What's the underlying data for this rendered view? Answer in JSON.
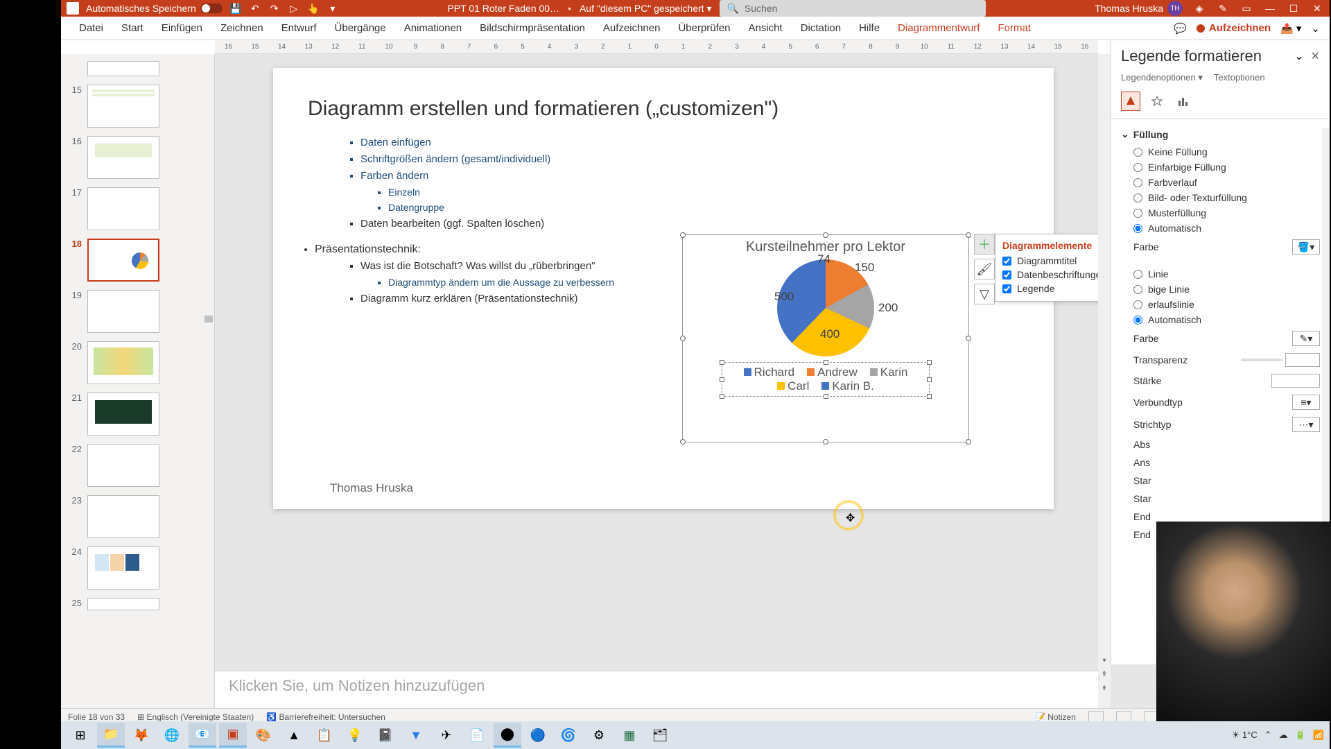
{
  "titlebar": {
    "autosave_label": "Automatisches Speichern",
    "filename": "PPT 01 Roter Faden 00…",
    "saved_status": "Auf \"diesem PC\" gespeichert",
    "search_placeholder": "Suchen",
    "user_name": "Thomas Hruska",
    "user_initials": "TH"
  },
  "ribbon": {
    "tabs": [
      "Datei",
      "Start",
      "Einfügen",
      "Zeichnen",
      "Entwurf",
      "Übergänge",
      "Animationen",
      "Bildschirmpräsentation",
      "Aufzeichnen",
      "Überprüfen",
      "Ansicht",
      "Dictation",
      "Hilfe",
      "Diagrammentwurf",
      "Format"
    ],
    "record_btn": "Aufzeichnen"
  },
  "ruler_h": [
    "16",
    "15",
    "14",
    "13",
    "12",
    "11",
    "10",
    "9",
    "8",
    "7",
    "6",
    "5",
    "4",
    "3",
    "2",
    "1",
    "0",
    "1",
    "2",
    "3",
    "4",
    "5",
    "6",
    "7",
    "8",
    "9",
    "10",
    "11",
    "12",
    "13",
    "14",
    "15",
    "16"
  ],
  "thumbs": [
    {
      "num": ""
    },
    {
      "num": "15"
    },
    {
      "num": "16"
    },
    {
      "num": "17"
    },
    {
      "num": "18",
      "selected": true
    },
    {
      "num": "19"
    },
    {
      "num": "20"
    },
    {
      "num": "21"
    },
    {
      "num": "22"
    },
    {
      "num": "23"
    },
    {
      "num": "24"
    },
    {
      "num": "25"
    }
  ],
  "slide": {
    "title": "Diagramm erstellen und formatieren („customizen\")",
    "bullets": {
      "b1": "Daten einfügen",
      "b2": "Schriftgrößen ändern (gesamt/individuell)",
      "b3": "Farben ändern",
      "b3a": "Einzeln",
      "b3b": "Datengruppe",
      "b4": "Daten bearbeiten (ggf. Spalten löschen)",
      "s2": "Präsentationstechnik:",
      "s2a": "Was ist die Botschaft? Was willst du „rüberbringen\"",
      "s2b": "Diagrammtyp ändern um die Aussage zu verbessern",
      "s2c": "Diagramm kurz erklären (Präsentationstechnik)"
    },
    "footer": "Thomas Hruska"
  },
  "chart_data": {
    "type": "pie",
    "title": "Kursteilnehmer pro Lektor",
    "series": [
      {
        "name": "Richard",
        "value": 500,
        "color": "#4472c4"
      },
      {
        "name": "Andrew",
        "value": 150,
        "color": "#ed7d31"
      },
      {
        "name": "Karin",
        "value": 200,
        "color": "#a5a5a5"
      },
      {
        "name": "Carl",
        "value": 400,
        "color": "#ffc000"
      },
      {
        "name": "Karin B.",
        "value": 74,
        "color": "#70ad47"
      }
    ],
    "labels": {
      "l74": "74",
      "l150": "150",
      "l200": "200",
      "l400": "400",
      "l500": "500"
    }
  },
  "chart_popup": {
    "title": "Diagrammelemente",
    "items": {
      "i1": "Diagrammtitel",
      "i2": "Datenbeschriftungen",
      "i3": "Legende"
    }
  },
  "format_pane": {
    "title": "Legende formatieren",
    "tab1": "Legendenoptionen",
    "tab2": "Textoptionen",
    "section_fill": "Füllung",
    "fill_opts": {
      "none": "Keine Füllung",
      "solid": "Einfarbige Füllung",
      "gradient": "Farbverlauf",
      "picture": "Bild- oder Texturfüllung",
      "pattern": "Musterfüllung",
      "auto": "Automatisch"
    },
    "color_label": "Farbe",
    "line_opts": {
      "noline": "Linie",
      "solidline": "bige Linie",
      "gradientline": "erlaufslinie",
      "autoline": "Automatisch"
    },
    "line_color": "Farbe",
    "transparency": "Transparenz",
    "width": "Stärke",
    "compound": "Verbundtyp",
    "dash": "Strichtyp",
    "cap": "Abs",
    "join": "Ans",
    "begin_arrow": "Star",
    "begin_size": "Star",
    "end_arrow": "End",
    "end_size": "End"
  },
  "notes": {
    "placeholder": "Klicken Sie, um Notizen hinzuzufügen"
  },
  "statusbar": {
    "slide_count": "Folie 18 von 33",
    "language": "Englisch (Vereinigte Staaten)",
    "accessibility": "Barrierefreiheit: Untersuchen",
    "notes_btn": "Notizen"
  },
  "taskbar": {
    "weather": "1°C"
  }
}
